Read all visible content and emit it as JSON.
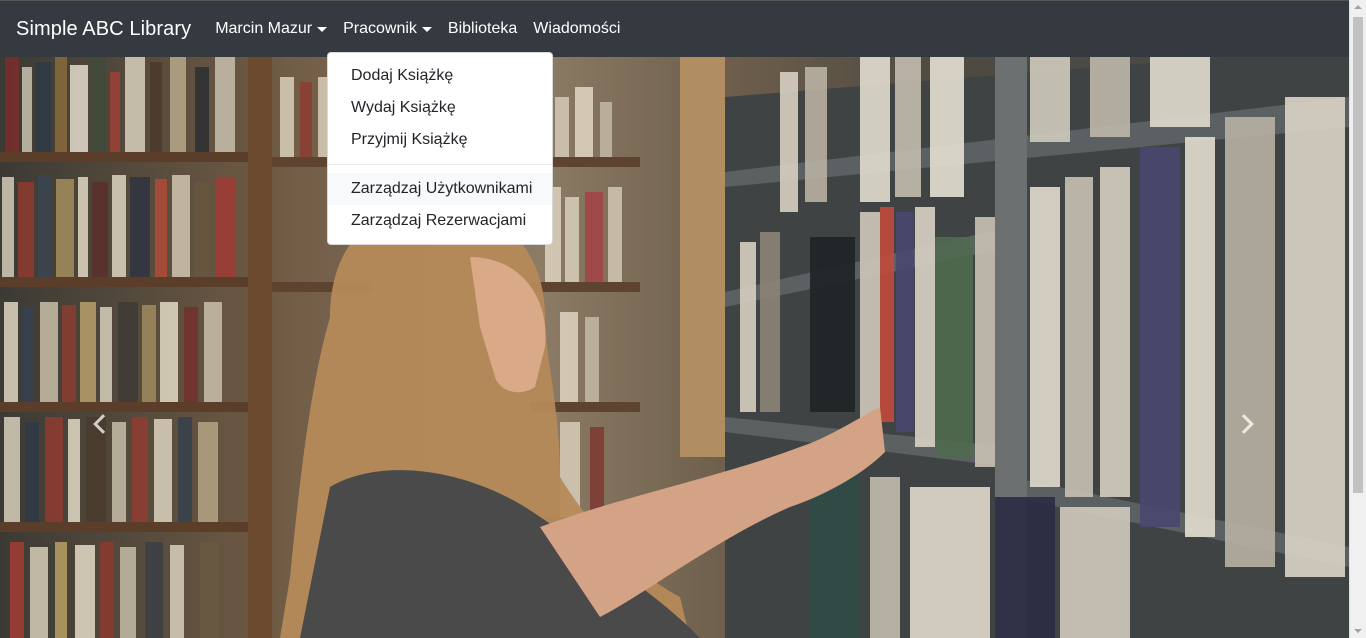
{
  "navbar": {
    "brand": "Simple ABC Library",
    "items": [
      {
        "label": "Marcin Mazur",
        "dropdown": true
      },
      {
        "label": "Pracownik",
        "dropdown": true
      },
      {
        "label": "Biblioteka",
        "dropdown": false
      },
      {
        "label": "Wiadomości",
        "dropdown": false
      }
    ]
  },
  "dropdown_menu": {
    "items": [
      "Dodaj Książkę",
      "Wydaj Książkę",
      "Przyjmij Książkę",
      "Zarządzaj Użytkownikami",
      "Zarządzaj Rezerwacjami"
    ],
    "hovered_item": "Zarządzaj Użytkownikami"
  },
  "carousel": {
    "prev_icon": "chevron-left-icon",
    "next_icon": "chevron-right-icon"
  }
}
